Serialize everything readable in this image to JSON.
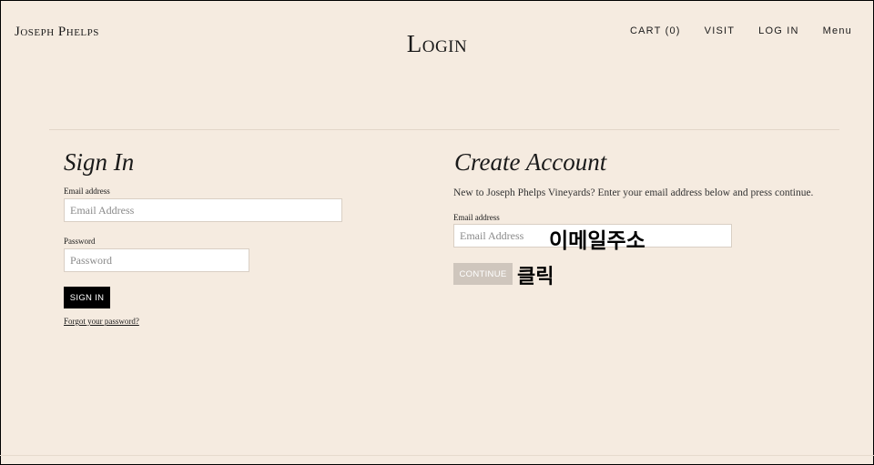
{
  "header": {
    "logo": "Joseph Phelps",
    "title": "Login",
    "nav": [
      {
        "label": "CART (0)"
      },
      {
        "label": "VISIT"
      },
      {
        "label": "LOG IN"
      },
      {
        "label": "Menu"
      }
    ]
  },
  "sign_in": {
    "title": "Sign In",
    "email_label": "Email address",
    "email_placeholder": "Email Address",
    "password_label": "Password",
    "password_placeholder": "Password",
    "button": "SIGN IN",
    "forgot": "Forgot your password?"
  },
  "create_account": {
    "title": "Create Account",
    "intro": "New to Joseph Phelps Vineyards? Enter your email address below and press continue.",
    "email_label": "Email address",
    "email_placeholder": "Email Address",
    "button": "CONTINUE"
  },
  "annotations": {
    "email": "이메일주소",
    "click": "클릭"
  },
  "colors": {
    "background": "#f5ebe0",
    "primary_button": "#000000",
    "disabled_button": "#cfc6bd"
  }
}
